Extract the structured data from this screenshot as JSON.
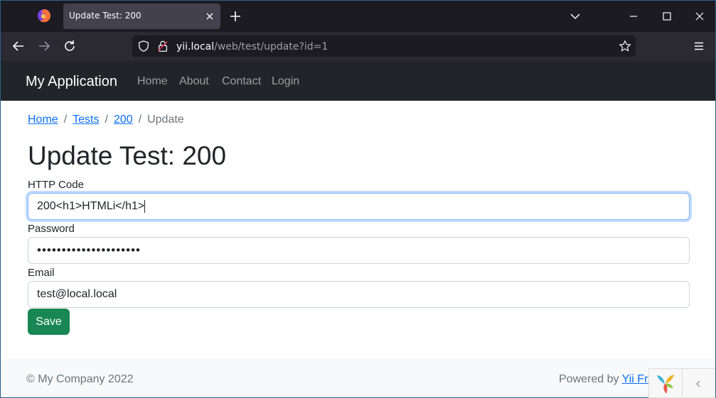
{
  "browser": {
    "tab_title": "Update Test: 200",
    "url_host": "yii.local",
    "url_path": "/web/test/update?id=1"
  },
  "app": {
    "brand": "My Application",
    "nav": [
      "Home",
      "About",
      "Contact",
      "Login"
    ]
  },
  "breadcrumb": {
    "items": [
      "Home",
      "Tests",
      "200"
    ],
    "current": "Update",
    "separator": "/"
  },
  "page": {
    "title": "Update Test: 200"
  },
  "form": {
    "http_code_label": "HTTP Code",
    "http_code_value": "200<h1>HTMLi</h1>",
    "password_label": "Password",
    "password_value": "•••••••••••••••••••••",
    "email_label": "Email",
    "email_value": "test@local.local",
    "save_label": "Save"
  },
  "footer": {
    "copyright": "© My Company 2022",
    "powered_by": "Powered by ",
    "framework_link": "Yii Framework"
  },
  "colors": {
    "navbar": "#212529",
    "primary": "#0d6efd",
    "success": "#198754"
  }
}
